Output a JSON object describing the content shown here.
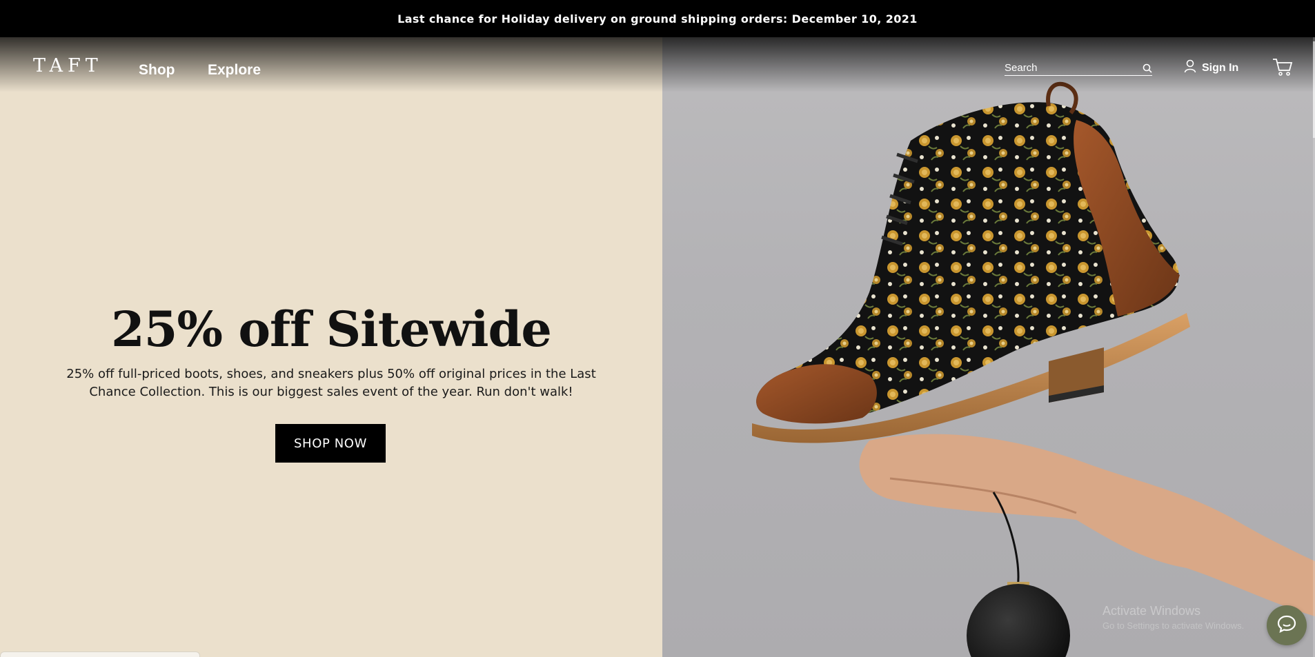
{
  "announcement": {
    "text": "Last chance for Holiday delivery on ground shipping orders: December 10, 2021"
  },
  "header": {
    "logo": "TAFT",
    "nav": [
      {
        "label": "Shop"
      },
      {
        "label": "Explore"
      }
    ],
    "search": {
      "placeholder": "Search",
      "icon": "search-icon"
    },
    "account": {
      "label": "Sign In",
      "icon": "user-icon"
    },
    "cart": {
      "icon": "cart-icon"
    }
  },
  "hero": {
    "headline": "25% off Sitewide",
    "description": "25% off full-priced boots, shoes, and sneakers plus 50% off original prices in the Last Chance Collection. This is our biggest sales event of the year. Run don't walk!",
    "cta_label": "SHOP NOW",
    "image_subject": "floral boot held on hand with black ornament",
    "background_color": "#ebe0cc",
    "image_background": "#b1b0b3"
  },
  "overlay": {
    "watermark": "Activate Windows",
    "watermark_sub": "Go to Settings to activate Windows."
  },
  "chat": {
    "icon": "chat-bubble-icon",
    "color": "#6b7453"
  }
}
